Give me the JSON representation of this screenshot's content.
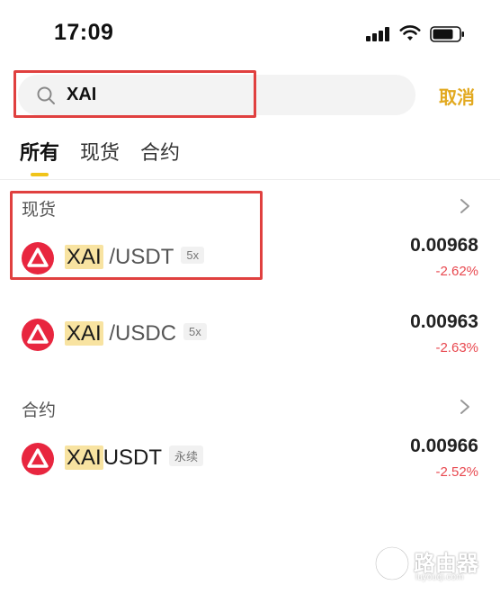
{
  "status_bar": {
    "time": "17:09"
  },
  "search": {
    "value": "XAI",
    "cancel_label": "取消"
  },
  "tabs": [
    {
      "label": "所有",
      "active": true
    },
    {
      "label": "现货",
      "active": false
    },
    {
      "label": "合约",
      "active": false
    }
  ],
  "sections": {
    "spot": {
      "title": "现货",
      "items": [
        {
          "base": "XAI",
          "quote": " /USDT",
          "badge": "5x",
          "price": "0.00968",
          "change": "-2.62%"
        },
        {
          "base": "XAI",
          "quote": " /USDC",
          "badge": "5x",
          "price": "0.00963",
          "change": "-2.63%"
        }
      ]
    },
    "futures": {
      "title": "合约",
      "items": [
        {
          "base": "XAI",
          "quote": "USDT",
          "badge": "永续",
          "price": "0.00966",
          "change": "-2.52%"
        }
      ]
    }
  },
  "colors": {
    "accent": "#e2a920",
    "negative": "#e8484f",
    "coin": "#e8263f",
    "annotation": "#e0403f"
  },
  "icons": {
    "search": "search-icon",
    "chevron": "chevron-right-icon",
    "coin": "xai-coin-icon"
  },
  "watermark": {
    "text": "路由器",
    "sub": "luyouqi.com"
  }
}
